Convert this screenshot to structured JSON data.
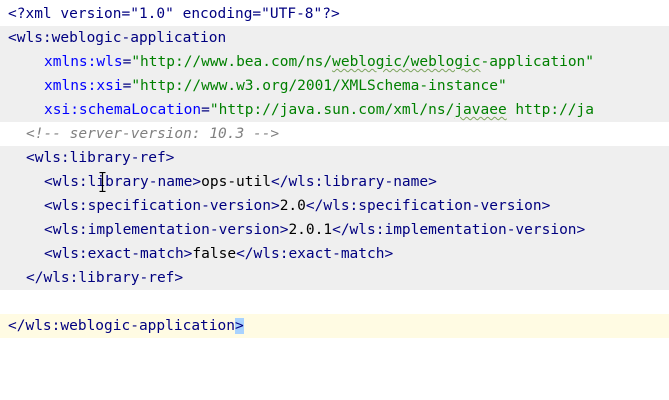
{
  "editor": {
    "lines": [
      {
        "decl": "<?xml version=\"1.0\" encoding=\"UTF-8\"?>"
      },
      {
        "open_tag": "<wls:weblogic-application"
      },
      {
        "attr1_name": "xmlns:wls",
        "attr1_value": "\"http://www.bea.com/ns/weblogic/weblogic-application\""
      },
      {
        "attr2_name": "xmlns:xsi",
        "attr2_value": "\"http://www.w3.org/2001/XMLSchema-instance\""
      },
      {
        "attr3_name": "xsi:schemaLocation",
        "attr3_value": "\"http://java.sun.com/xml/ns/javaee http://ja"
      },
      {
        "comment": "<!-- server-version: 10.3 -->"
      },
      {
        "open_tag": "<wls:library-ref>"
      },
      {
        "open": "<wls:library-name>",
        "text": "ops-util",
        "close": "</wls:library-name>"
      },
      {
        "open": "<wls:specification-version>",
        "text": "2.0",
        "close": "</wls:specification-version>"
      },
      {
        "open": "<wls:implementation-version>",
        "text": "2.0.1",
        "close": "</wls:implementation-version>"
      },
      {
        "open": "<wls:exact-match>",
        "text": "false",
        "close": "</wls:exact-match>"
      },
      {
        "close_tag": "</wls:library-ref>"
      },
      {
        "blank": ""
      },
      {
        "close_tag": "</wls:weblogic-application",
        "close_bracket": ">"
      }
    ],
    "colors": {
      "tag": "#000080",
      "attribute_name": "#0000ff",
      "attribute_value": "#008000",
      "comment": "#808080",
      "text": "#000000",
      "selection_gray": "#efefef",
      "caret_line": "#fffbe3",
      "bracket_match": "#a8d2ff"
    },
    "icons": [
      "fold-collapse-icon",
      "fold-end-icon",
      "text-cursor-icon"
    ]
  }
}
